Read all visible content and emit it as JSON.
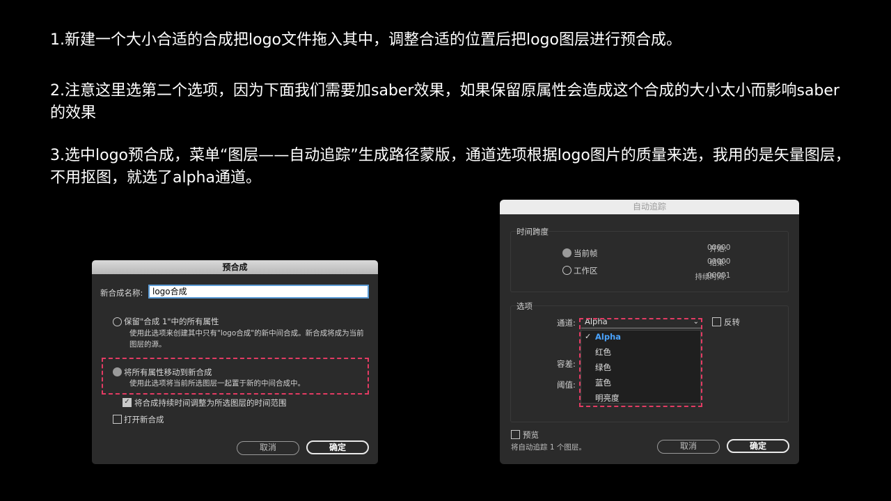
{
  "instructions": {
    "step1": "1.新建一个大小合适的合成把logo文件拖入其中，调整合适的位置后把logo图层进行预合成。",
    "step2": "2.注意这里选第二个选项，因为下面我们需要加saber效果，如果保留原属性会造成这个合成的大小太小而影响saber的效果",
    "step3": "3.选中logo预合成，菜单“图层——自动追踪”生成路径蒙版，通道选项根据logo图片的质量来选，我用的是矢量图层，不用抠图，就选了alpha通道。"
  },
  "precompose": {
    "title": "预合成",
    "name_label": "新合成名称:",
    "name_value": "logo合成",
    "option1_label": "保留\"合成 1\"中的所有属性",
    "option1_desc": "使用此选项来创建其中只有\"logo合成\"的新中间合成。新合成将成为当前图层的源。",
    "option2_label": "将所有属性移动到新合成",
    "option2_desc": "使用此选项将当前所选图层一起置于新的中间合成中。",
    "adjust_duration_label": "将合成持续时间调整为所选图层的时间范围",
    "adjust_duration_checked": true,
    "open_new_label": "打开新合成",
    "open_new_checked": false,
    "cancel_label": "取消",
    "ok_label": "确定",
    "highlight_color": "#e33b63"
  },
  "autotrace": {
    "title": "自动追踪",
    "time_span_label": "时间跨度",
    "current_frame_label": "当前帧",
    "work_area_label": "工作区",
    "start_label": "开始:",
    "start_value": "00000",
    "end_label": "结束:",
    "end_value": "00000",
    "duration_label": "持续时间:",
    "duration_value": "00001",
    "options_label": "选项",
    "channel_label": "通道:",
    "channel_value": "Alpha",
    "invert_label": "反转",
    "tolerance_label": "容差:",
    "threshold_label": "阈值:",
    "channel_options": [
      "Alpha",
      "红色",
      "绿色",
      "蓝色",
      "明亮度"
    ],
    "selected_option": "Alpha",
    "preview_label": "预览",
    "status_text": "将自动追踪 1 个图层。",
    "cancel_label": "取消",
    "ok_label": "确定",
    "selected_color": "#4aa3ff",
    "highlight_color": "#e33b63"
  }
}
